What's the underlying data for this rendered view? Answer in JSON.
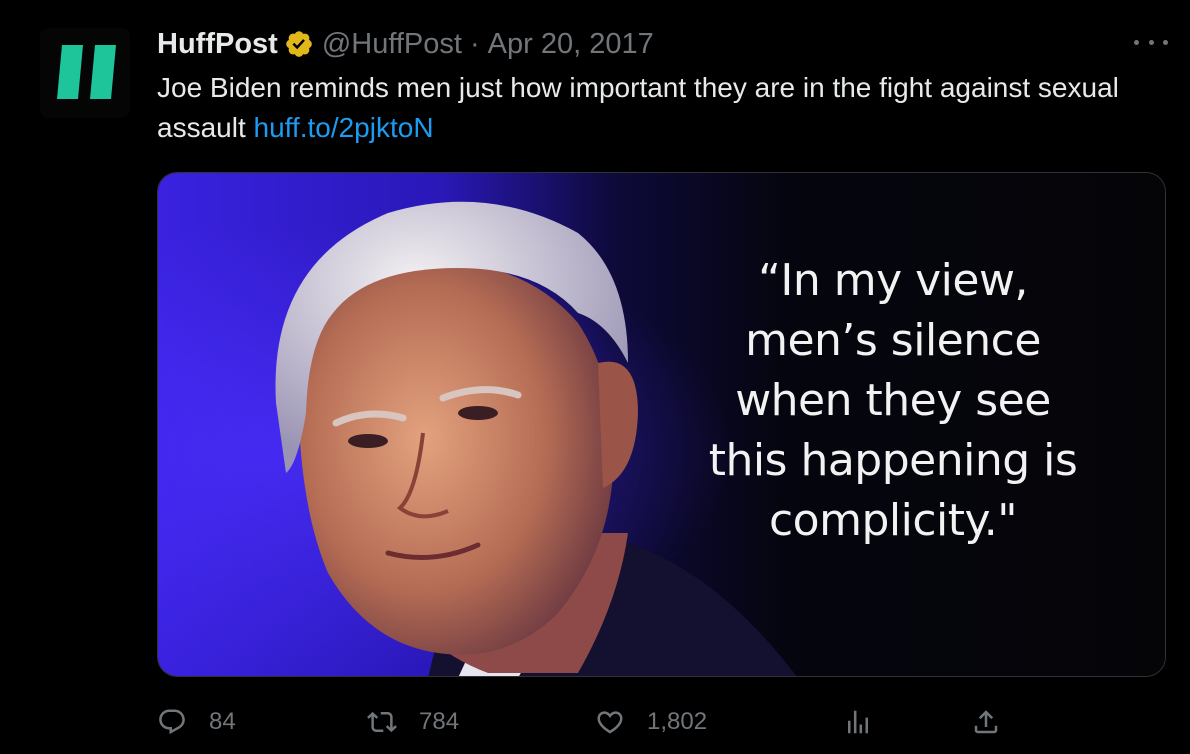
{
  "author": {
    "display_name": "HuffPost",
    "handle": "@HuffPost",
    "separator": "·",
    "date": "Apr 20, 2017",
    "verified_icon": "verified-badge-icon",
    "avatar_icon": "huffpost-logo-icon"
  },
  "tweet": {
    "text": "Joe Biden reminds men just how important they are in the fight against sexual assault ",
    "link": "huff.to/2pjktoN"
  },
  "media": {
    "quote_lines": [
      "“In my view,",
      "men’s silence",
      "when they see",
      "this happening is",
      "complicity.\""
    ]
  },
  "actions": {
    "reply": {
      "icon": "reply-icon",
      "count": "84"
    },
    "retweet": {
      "icon": "retweet-icon",
      "count": "784"
    },
    "like": {
      "icon": "heart-icon",
      "count": "1,802"
    },
    "views": {
      "icon": "views-icon"
    },
    "share": {
      "icon": "share-icon"
    }
  },
  "colors": {
    "background": "#000000",
    "text": "#e7e9ea",
    "muted": "#71767b",
    "link": "#1d9bf0",
    "brand": "#1ec59a",
    "verified_gold": "#e2b719"
  }
}
